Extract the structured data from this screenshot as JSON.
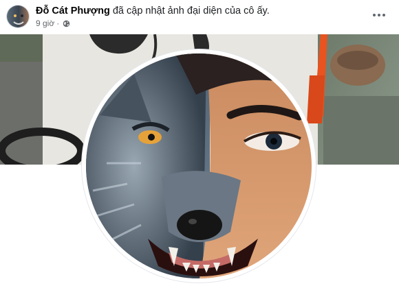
{
  "post": {
    "author_name": "Đỗ Cát Phượng",
    "action_text": "đã cập nhật ảnh đại diện của cô ấy.",
    "time_ago": "9 giờ",
    "separator": "·",
    "privacy_icon": "globe-icon",
    "more_icon": "more-horizontal-icon"
  },
  "cover_photo": {
    "description_icon": "cover-photo",
    "accent_color": "#e8531f"
  },
  "profile_photo": {
    "icon": "wolf-human-face-photo"
  },
  "colors": {
    "name_text": "#050505",
    "meta_text": "#65676b",
    "background": "#ffffff"
  }
}
